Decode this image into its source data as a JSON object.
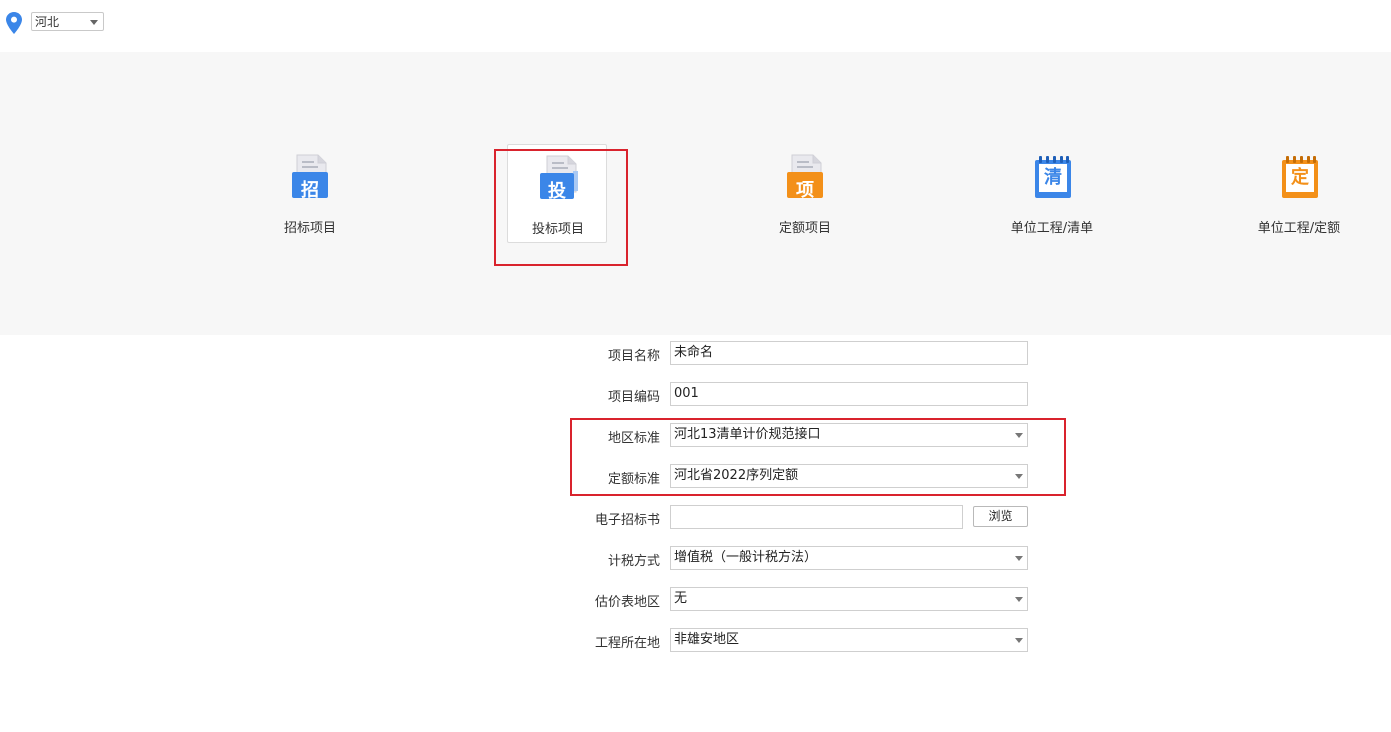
{
  "region": {
    "selected": "河北"
  },
  "project_types": [
    {
      "label": "招标项目",
      "glyph": "招",
      "color": "#3b86e8",
      "icon": "document-zhao-icon",
      "selected": false
    },
    {
      "label": "投标项目",
      "glyph": "投",
      "color": "#3b86e8",
      "icon": "document-tou-icon",
      "selected": true
    },
    {
      "label": "定额项目",
      "glyph": "项",
      "color": "#f39019",
      "icon": "document-xiang-icon",
      "selected": false
    },
    {
      "label": "单位工程/清单",
      "glyph": "清",
      "color": "#3b86e8",
      "icon": "notepad-qing-icon",
      "selected": false
    },
    {
      "label": "单位工程/定额",
      "glyph": "定",
      "color": "#f39019",
      "icon": "notepad-ding-icon",
      "selected": false
    }
  ],
  "form": {
    "project_name": {
      "label": "项目名称",
      "value": "未命名"
    },
    "project_code": {
      "label": "项目编码",
      "value": "001"
    },
    "region_standard": {
      "label": "地区标准",
      "value": "河北13清单计价规范接口"
    },
    "quota_standard": {
      "label": "定额标准",
      "value": "河北省2022序列定额"
    },
    "e_tender": {
      "label": "电子招标书",
      "value": "",
      "browse_label": "浏览"
    },
    "tax_method": {
      "label": "计税方式",
      "value": "增值税（一般计税方法）"
    },
    "estimate_region": {
      "label": "估价表地区",
      "value": "无"
    },
    "project_location": {
      "label": "工程所在地",
      "value": "非雄安地区"
    }
  },
  "colors": {
    "accent_blue": "#3b86e8",
    "accent_orange": "#f39019",
    "highlight_red": "#d9232d",
    "panel_bg": "#f7f7f7"
  }
}
